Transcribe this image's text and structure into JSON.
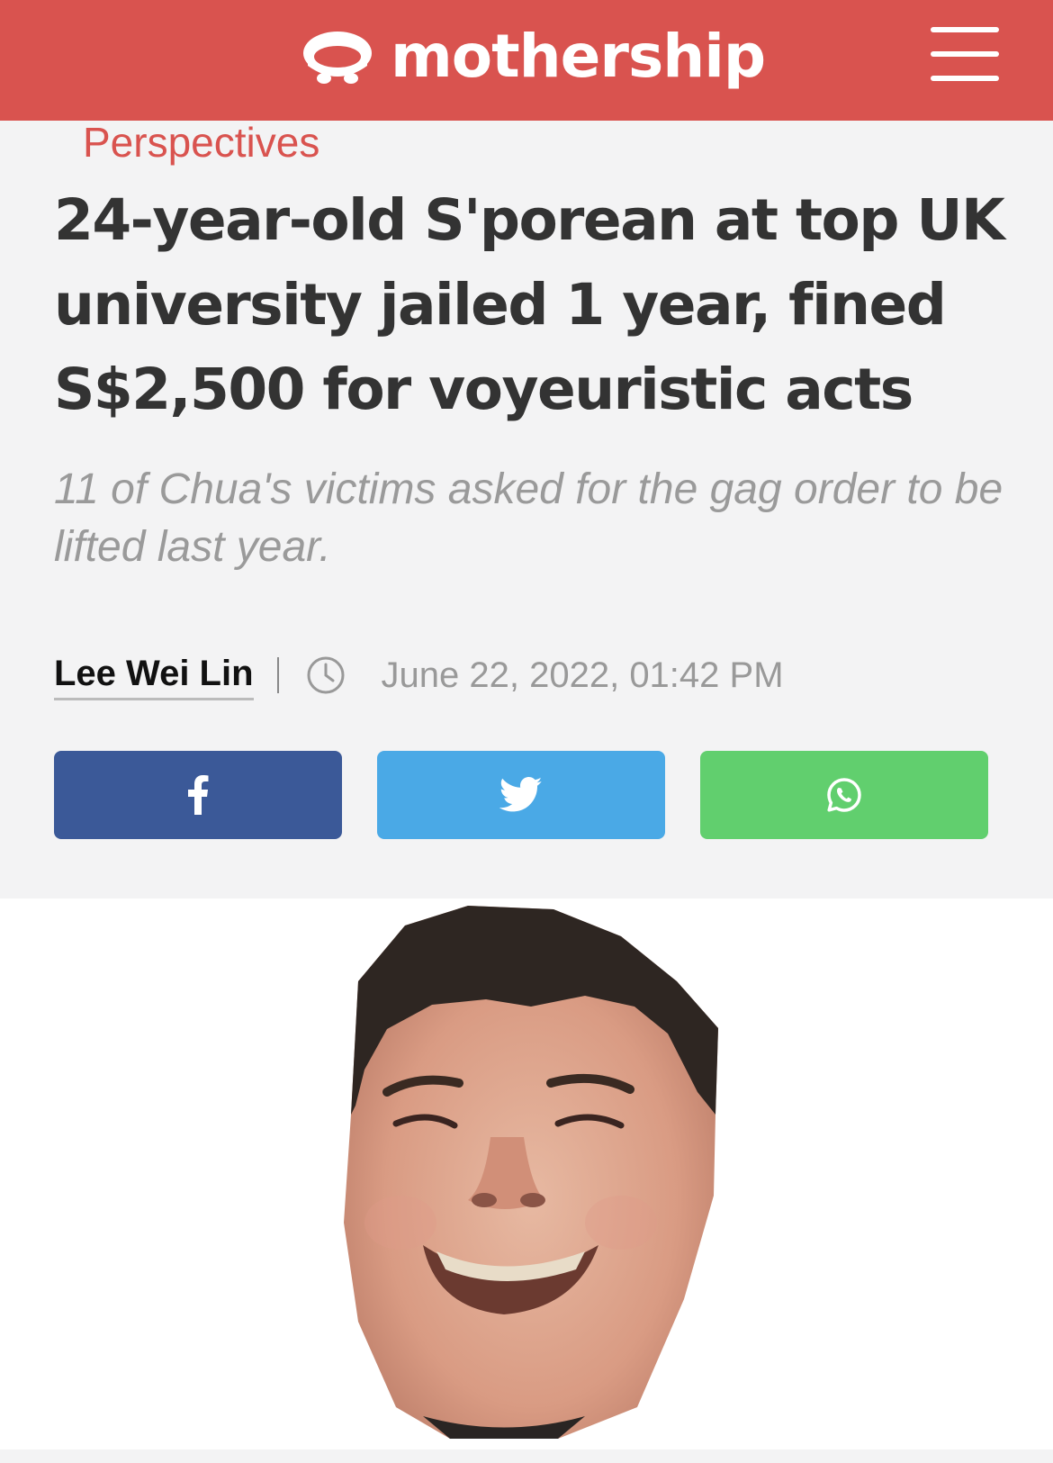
{
  "brand": {
    "name": "mothership",
    "color": "#d9534f",
    "logo_icon": "ufo-logo-icon"
  },
  "menu": {
    "icon": "hamburger-menu-icon"
  },
  "article": {
    "category": "Perspectives",
    "headline": "24-year-old S'porean at top UK university jailed 1 year, fined S$2,500 for voyeuristic acts",
    "subtitle": "11 of Chua's victims asked for the gag order to be lifted last year.",
    "author": "Lee Wei Lin",
    "timestamp": "June 22, 2022, 01:42 PM",
    "timestamp_icon": "clock-icon"
  },
  "share": [
    {
      "network": "facebook",
      "icon": "facebook-icon",
      "color": "#3b5998"
    },
    {
      "network": "twitter",
      "icon": "twitter-icon",
      "color": "#4aa9e6"
    },
    {
      "network": "whatsapp",
      "icon": "whatsapp-icon",
      "color": "#61cf6e"
    }
  ],
  "image": {
    "subject": "cutout-face-photo"
  }
}
